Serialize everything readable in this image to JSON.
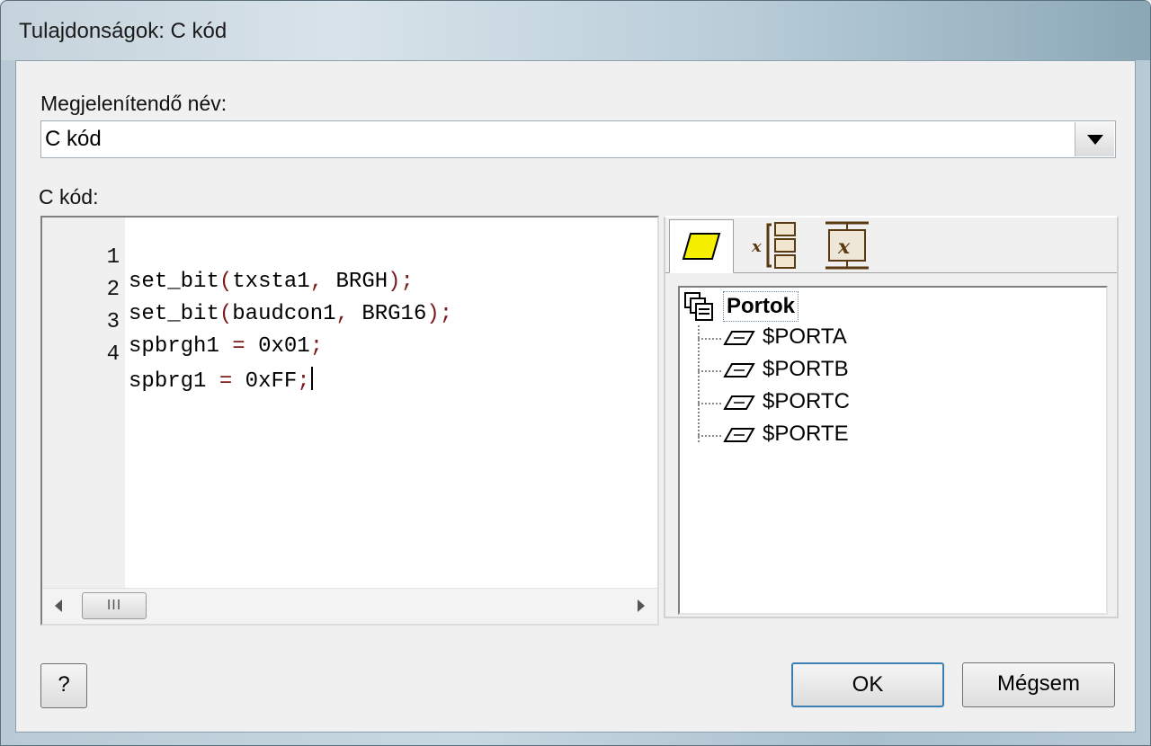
{
  "window": {
    "title": "Tulajdonságok: C kód"
  },
  "form": {
    "display_name_label": "Megjelenítendő név:",
    "display_name_value": "C kód",
    "code_label": "C kód:"
  },
  "editor": {
    "lines": [
      {
        "num": "1",
        "text": "set_bit(txsta1, BRGH);"
      },
      {
        "num": "2",
        "text": "set_bit(baudcon1, BRG16);"
      },
      {
        "num": "3",
        "text": "spbrgh1 = 0x01;"
      },
      {
        "num": "4",
        "text": "spbrg1 = 0xFF;"
      }
    ],
    "scroll_thumb_grip": "III"
  },
  "panel": {
    "tabs": [
      {
        "icon": "flowchart-io-icon",
        "active": true
      },
      {
        "icon": "variable-tree-icon",
        "active": false
      },
      {
        "icon": "component-x-icon",
        "active": false
      }
    ],
    "tree": {
      "root": "Portok",
      "items": [
        "$PORTA",
        "$PORTB",
        "$PORTC",
        "$PORTE"
      ]
    }
  },
  "buttons": {
    "help": "?",
    "ok": "OK",
    "cancel": "Mégsem"
  },
  "colors": {
    "punctuation": "#7a1b1b",
    "io_icon_fill": "#f4f000",
    "focus_border": "#3c7fb1"
  }
}
